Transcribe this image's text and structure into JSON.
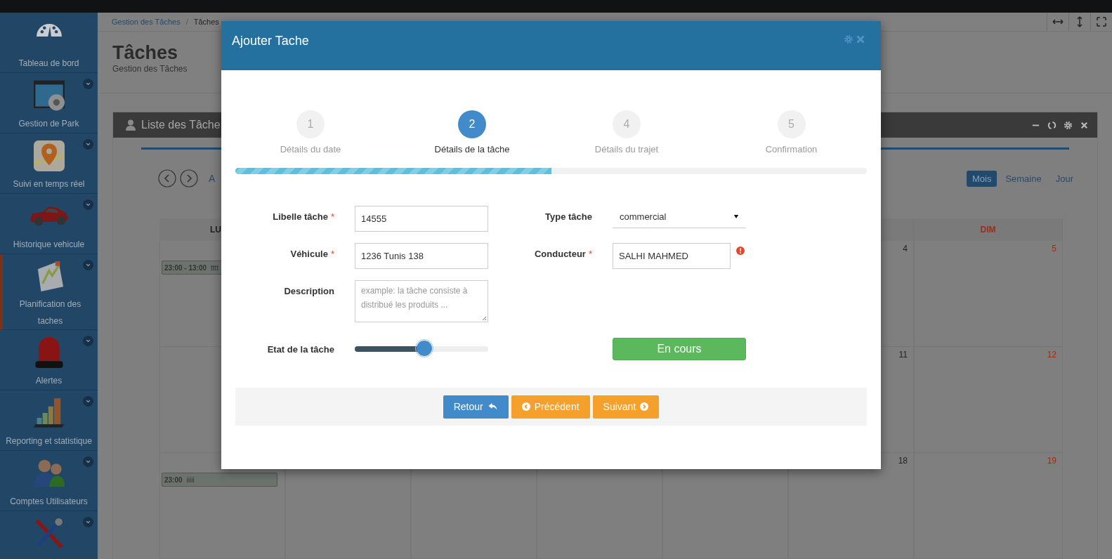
{
  "sidebar": {
    "items": [
      {
        "label": "Tableau de bord",
        "has_submenu": false,
        "selected": false
      },
      {
        "label": "Gestion de Park",
        "has_submenu": true,
        "selected": false
      },
      {
        "label": "Suivi en temps réel",
        "has_submenu": true,
        "selected": false
      },
      {
        "label": "Historique vehicule",
        "has_submenu": true,
        "selected": false
      },
      {
        "label": "Planification des taches",
        "has_submenu": true,
        "selected": true
      },
      {
        "label": "Alertes",
        "has_submenu": true,
        "selected": false
      },
      {
        "label": "Reporting et statistique",
        "has_submenu": true,
        "selected": false
      },
      {
        "label": "Comptes Utilisateurs",
        "has_submenu": true,
        "selected": false
      },
      {
        "has_submenu": true,
        "selected": false
      }
    ]
  },
  "breadcrumb": {
    "items": [
      "Gestion des Tâches",
      "Tâches"
    ],
    "separator": "/"
  },
  "page": {
    "title": "Tâches",
    "subtitle": "Gestion des Tâches"
  },
  "panel": {
    "title": "Liste des Tâche"
  },
  "calendar": {
    "nav_label": "A",
    "views": [
      {
        "label": "Mois",
        "selected": true
      },
      {
        "label": "Semaine",
        "selected": false
      },
      {
        "label": "Jour",
        "selected": false
      }
    ],
    "headers": [
      {
        "label": "LU",
        "color": "#222222"
      },
      {
        "label": "DIM",
        "color": "#9e2b17"
      }
    ],
    "weeks": [
      {
        "cells": [
          {
            "events": [
              {
                "time": "23:00 - 13:00",
                "title": "tttt"
              }
            ]
          },
          {},
          {},
          {},
          {},
          {
            "date": "4",
            "color": "#222222"
          },
          {
            "date": "5",
            "color": "#9e2b17"
          }
        ]
      },
      {
        "cells": [
          {},
          {},
          {},
          {},
          {},
          {
            "date": "11",
            "color": "#222222"
          },
          {
            "date": "12",
            "color": "#9e2b17"
          }
        ]
      },
      {
        "cells": [
          {
            "events": [
              {
                "time": "23:00",
                "title": "iiiii"
              }
            ]
          },
          {},
          {},
          {},
          {},
          {
            "date": "18",
            "color": "#222222"
          },
          {
            "date": "19",
            "color": "#9e2b17"
          }
        ]
      }
    ]
  },
  "modal": {
    "title": "Ajouter Tache",
    "steps": [
      {
        "number": "1",
        "label": "Détails du date",
        "selected": false
      },
      {
        "number": "2",
        "label": "Détails de la tâche",
        "selected": true
      },
      {
        "number": "4",
        "label": "Détails du trajet",
        "selected": false
      },
      {
        "number": "5",
        "label": "Confirmation",
        "selected": false
      }
    ],
    "progress": {
      "level": 0.5
    },
    "fields": [
      {
        "label": "Libelle tâche",
        "kind": "text",
        "marker": "*",
        "value": "14555",
        "error": false
      },
      {
        "label": "Type tâche",
        "kind": "select",
        "value": "commercial",
        "error": false
      },
      {
        "label": "Véhicule",
        "kind": "text",
        "marker": "*",
        "value": "1236 Tunis 138",
        "error": false
      },
      {
        "label": "Conducteur",
        "kind": "text",
        "marker": "*",
        "value": "SALHI MAHMED",
        "error": true
      },
      {
        "label": "Description",
        "kind": "textarea",
        "placeholder": "example: la tâche consiste à distribué les produits ...",
        "error": false
      }
    ],
    "state": {
      "label": "Etat de la tâche",
      "level": 0.52,
      "status": "En cours"
    },
    "buttons": [
      {
        "label": "Retour",
        "kind": "back"
      },
      {
        "label": "Précédent",
        "kind": "prev"
      },
      {
        "label": "Suivant",
        "kind": "next"
      }
    ]
  }
}
